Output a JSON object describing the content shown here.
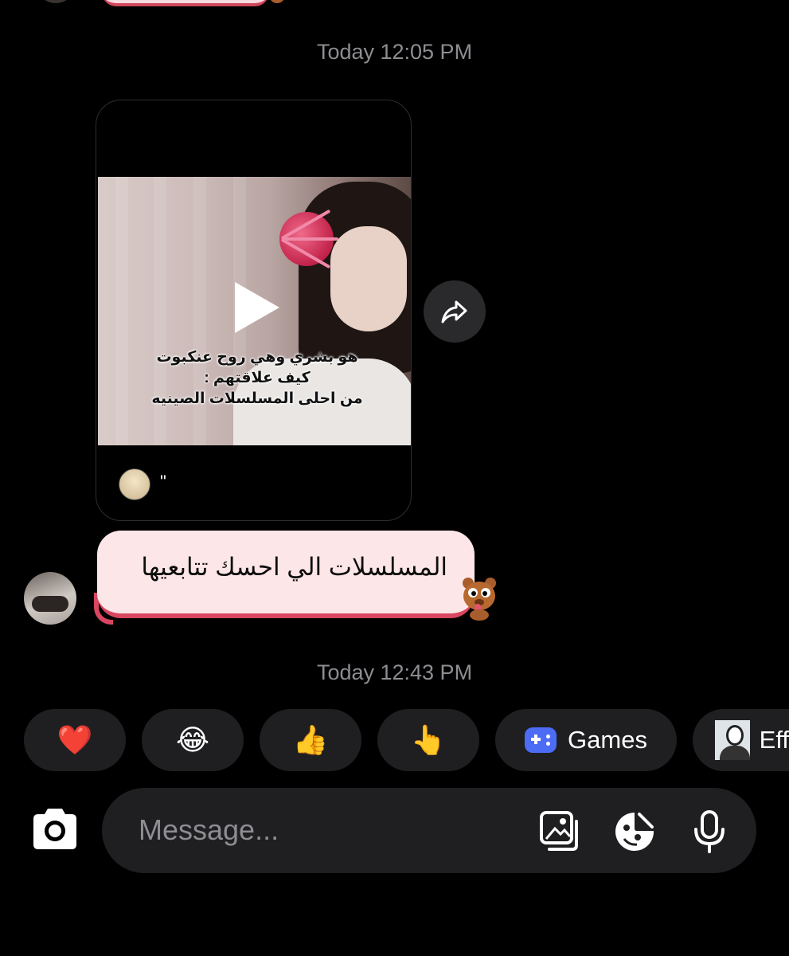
{
  "timestamps": {
    "first": "Today 12:05 PM",
    "second": "Today 12:43 PM"
  },
  "reel": {
    "caption_lines": [
      "هو بشري وهي روح عنكبوت",
      "كيف علاقتهم :",
      "من احلى المسلسلات الصينيه"
    ],
    "author_name": "\"",
    "play_icon": "play-icon",
    "share_icon": "share-arrow-icon"
  },
  "message": {
    "text": "المسلسلات الي احسك تتابعيها",
    "bubble_color": "#fde6e8",
    "accent_color": "#d8465f"
  },
  "quick_reactions": {
    "items": [
      "❤️",
      "😂",
      "👍",
      "👆"
    ],
    "games_label": "Games",
    "effects_label": "Eff"
  },
  "composer": {
    "placeholder": "Message...",
    "icons": [
      "camera-icon",
      "gallery-icon",
      "sticker-icon",
      "microphone-icon"
    ]
  },
  "colors": {
    "background": "#000000",
    "pill": "#1f1f21",
    "muted_text": "#8d8d92",
    "games_blue": "#4d6cf5"
  }
}
